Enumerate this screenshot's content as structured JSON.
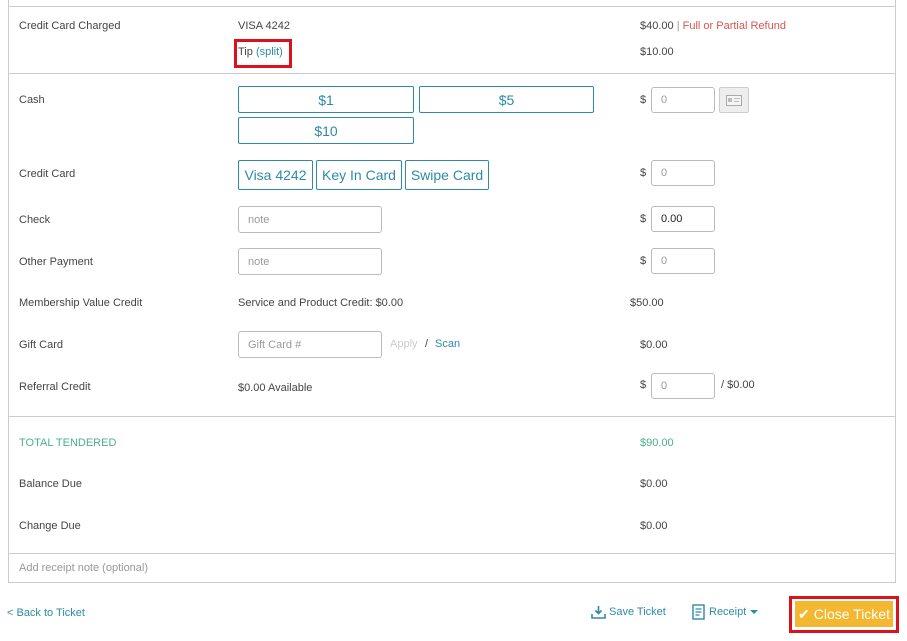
{
  "charged": {
    "label": "Credit Card Charged",
    "card": "VISA 4242",
    "amount": "$40.00",
    "separator": "|",
    "refund_link": "Full or Partial Refund",
    "tip_label": "Tip",
    "tip_split_open": "(",
    "tip_split": "split",
    "tip_split_close": ")",
    "tip_amount": "$10.00"
  },
  "cash": {
    "label": "Cash",
    "buttons": [
      "$1",
      "$5",
      "$10"
    ],
    "currency": "$",
    "value": "0"
  },
  "credit_card": {
    "label": "Credit Card",
    "buttons": [
      "Visa 4242",
      "Key In Card",
      "Swipe Card"
    ],
    "currency": "$",
    "value": "0"
  },
  "check": {
    "label": "Check",
    "placeholder": "note",
    "currency": "$",
    "value": "0.00"
  },
  "other_payment": {
    "label": "Other Payment",
    "placeholder": "note",
    "currency": "$",
    "value": "0"
  },
  "membership": {
    "label": "Membership Value Credit",
    "detail": "Service and Product Credit: $0.00",
    "amount": "$50.00"
  },
  "gift_card": {
    "label": "Gift Card",
    "placeholder": "Gift Card #",
    "apply": "Apply",
    "slash": "/",
    "scan": "Scan",
    "amount": "$0.00"
  },
  "referral": {
    "label": "Referral Credit",
    "available": "$0.00 Available",
    "currency": "$",
    "value": "0",
    "max": "/ $0.00"
  },
  "totals": {
    "tendered_label": "TOTAL TENDERED",
    "tendered_amount": "$90.00",
    "balance_label": "Balance Due",
    "balance_amount": "$0.00",
    "change_label": "Change Due",
    "change_amount": "$0.00"
  },
  "receipt_note_placeholder": "Add receipt note (optional)",
  "footer": {
    "back": "< Back to Ticket",
    "save": "Save Ticket",
    "receipt": "Receipt",
    "close": "Close Ticket"
  },
  "colors": {
    "accent": "#2e8aa8",
    "total_green": "#4caf8a",
    "refund_red": "#d9534f",
    "close_button": "#f4b731",
    "highlight_red": "#d9121f"
  }
}
